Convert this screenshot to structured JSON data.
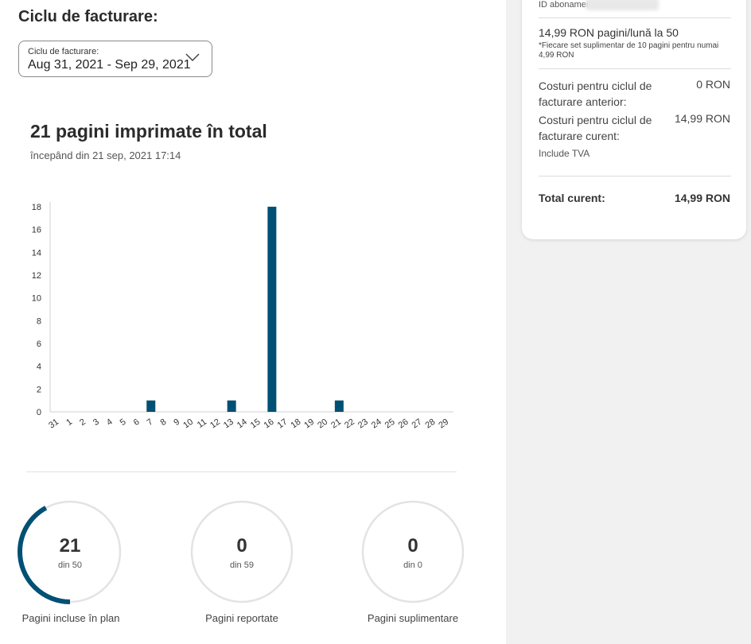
{
  "billing": {
    "section_title": "Ciclu de facturare:",
    "select_label": "Ciclu de facturare:",
    "select_value": "Aug 31, 2021 - Sep 29, 2021"
  },
  "summary": {
    "title": "21 pagini imprimate în total",
    "since": "începând din 21  sep, 2021 17:14"
  },
  "chart_data": {
    "type": "bar",
    "categories": [
      "31",
      "1",
      "2",
      "3",
      "4",
      "5",
      "6",
      "7",
      "8",
      "9",
      "10",
      "11",
      "12",
      "13",
      "14",
      "15",
      "16",
      "17",
      "18",
      "19",
      "20",
      "21",
      "22",
      "23",
      "24",
      "25",
      "26",
      "27",
      "28",
      "29"
    ],
    "values": [
      0,
      0,
      0,
      0,
      0,
      0,
      0,
      1,
      0,
      0,
      0,
      0,
      0,
      1,
      0,
      0,
      18,
      0,
      0,
      0,
      0,
      1,
      0,
      0,
      0,
      0,
      0,
      0,
      0,
      0
    ],
    "yticks": [
      0,
      2,
      4,
      6,
      8,
      10,
      12,
      14,
      16,
      18
    ],
    "ylim": [
      0,
      18
    ],
    "bar_color": "#005075",
    "title": "",
    "xlabel": "",
    "ylabel": ""
  },
  "gauges": [
    {
      "value": "21",
      "sub": "din 50",
      "label": "Pagini incluse în plan",
      "fraction": 0.42
    },
    {
      "value": "0",
      "sub": "din 59",
      "label": "Pagini reportate",
      "fraction": 0
    },
    {
      "value": "0",
      "sub": "din 0",
      "label": "Pagini suplimentare",
      "fraction": 0
    }
  ],
  "account": {
    "subscription_id_label": "ID abonamer",
    "plan": "14,99 RON pagini/lună la 50",
    "plan_note": "*Fiecare set suplimentar de 10 pagini pentru numai 4,99 RON",
    "prev_cost_label": "Costuri pentru ciclul de facturare anterior:",
    "prev_cost_value": "0 RON",
    "current_cost_label": "Costuri pentru ciclul de facturare curent:",
    "current_cost_value": "14,99 RON",
    "vat_note": "Include TVA",
    "total_label": "Total curent:",
    "total_value": "14,99 RON"
  },
  "colors": {
    "accent": "#005075",
    "gauge_track": "#e3e3e3"
  }
}
